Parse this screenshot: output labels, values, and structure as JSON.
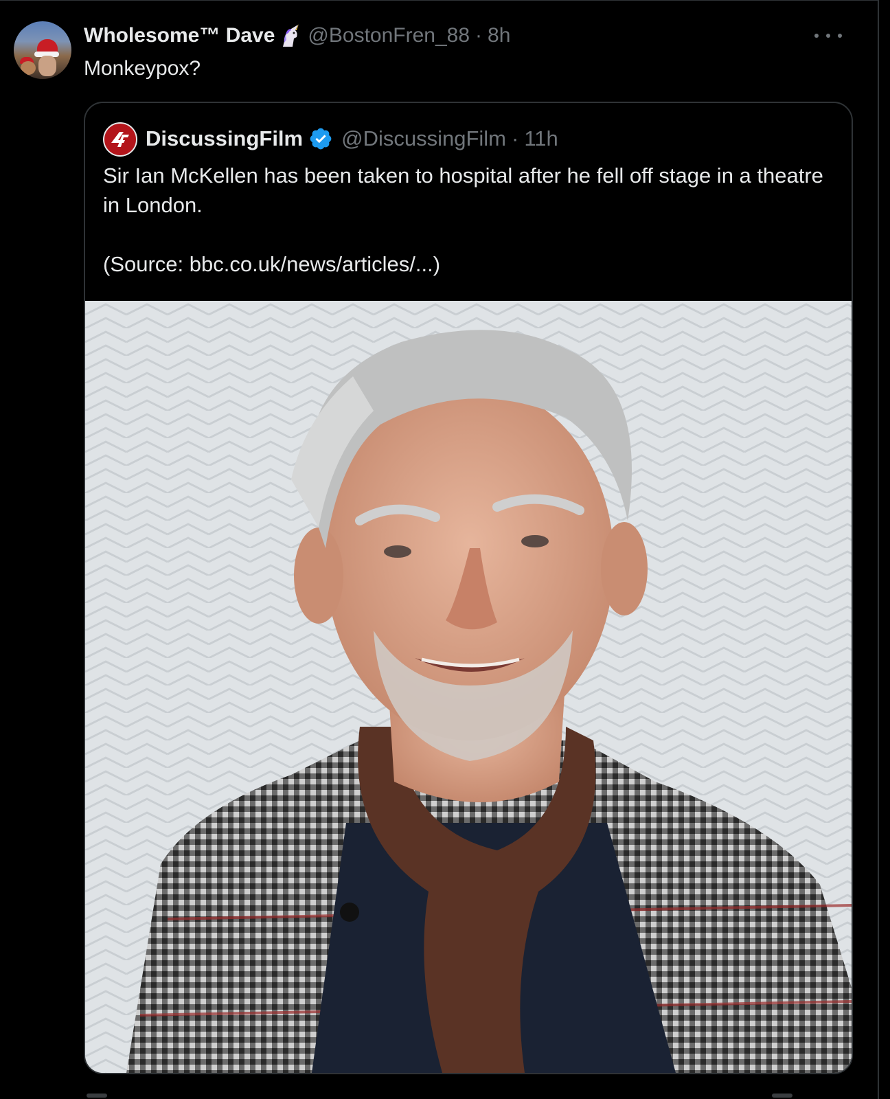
{
  "tweet": {
    "display_name": "Wholesome™ Dave",
    "handle": "@BostonFren_88",
    "separator": "·",
    "time": "8h",
    "text": "Monkeypox?",
    "avatar": "user-avatar",
    "badge_icon": "unicorn-icon",
    "more_icon": "more-options-icon"
  },
  "quoted_tweet": {
    "display_name": "DiscussingFilm",
    "handle": "@DiscussingFilm",
    "separator": "·",
    "time": "11h",
    "verified_icon": "verified-badge-icon",
    "logo_icon": "discussingfilm-logo-icon",
    "text_line1": "Sir Ian McKellen has been taken to hospital after he fell off stage in a theatre in London.",
    "text_line2": "(Source: bbc.co.uk/news/articles/...)",
    "image": "portrait-photo"
  },
  "colors": {
    "background": "#000000",
    "primary_text": "#e7e9ea",
    "secondary_text": "#71767b",
    "border": "#2f3336",
    "verified": "#1d9bf0",
    "logo_red": "#b3151b"
  }
}
